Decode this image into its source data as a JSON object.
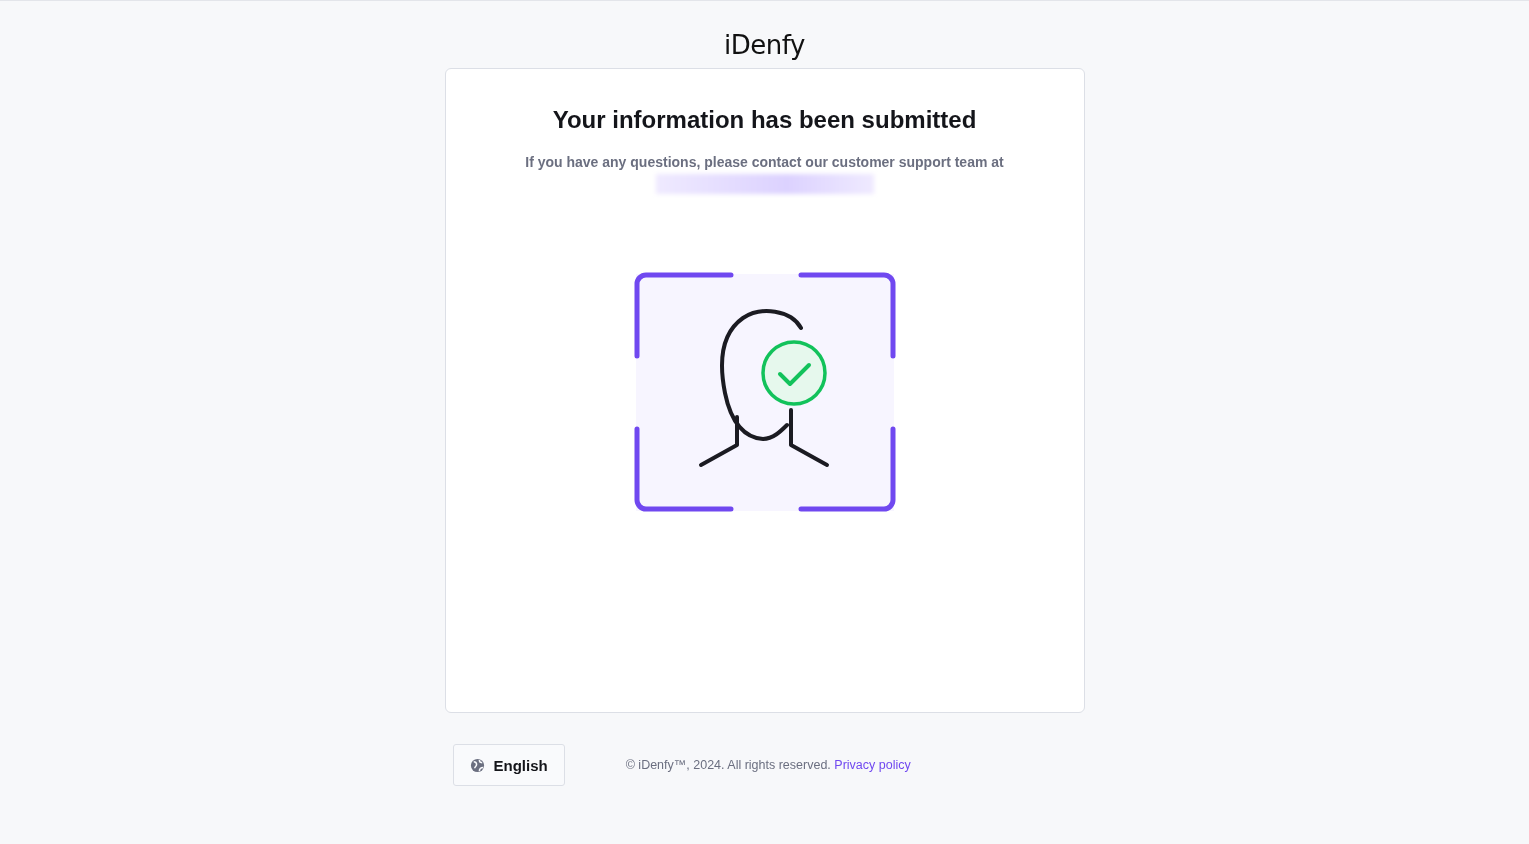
{
  "header": {
    "logo": "iDenfy"
  },
  "card": {
    "title": "Your information has been submitted",
    "message": "If you have any questions, please contact our customer support team at"
  },
  "footer": {
    "language_button": "English",
    "copyright": "© iDenfy™, 2024. All rights reserved.",
    "privacy_link": "Privacy policy"
  }
}
